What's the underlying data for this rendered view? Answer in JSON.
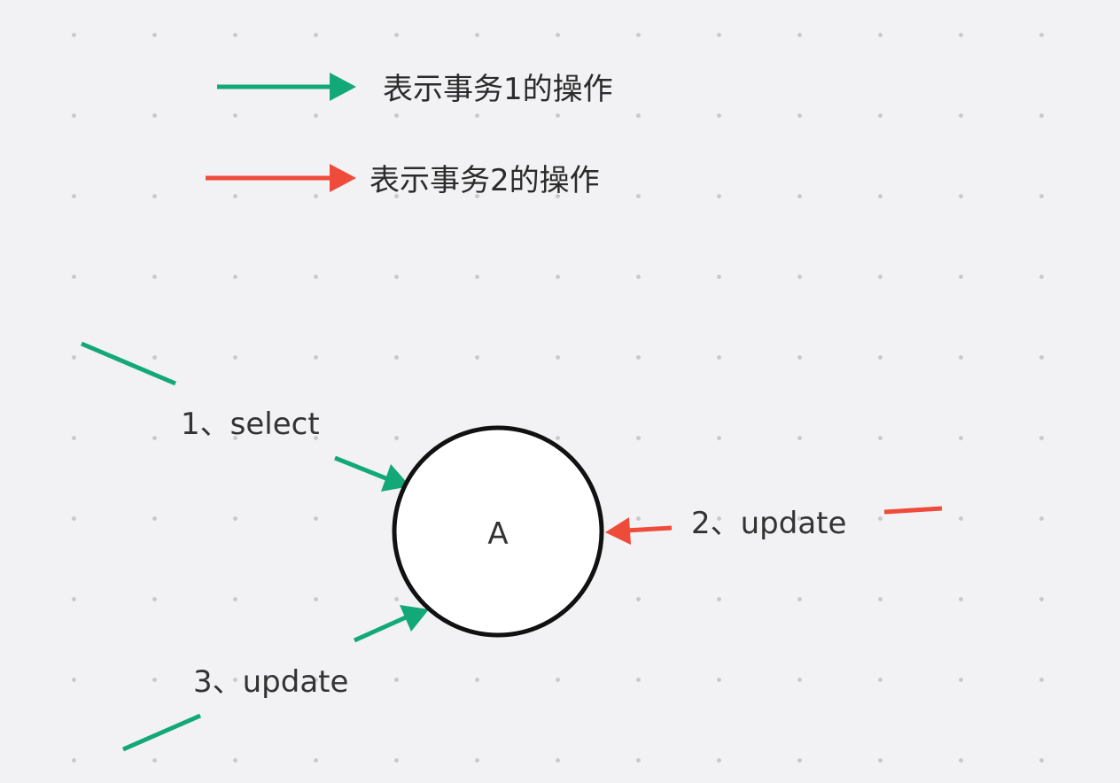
{
  "colors": {
    "transaction1": "#12a878",
    "transaction2": "#ef4b3b",
    "node_stroke": "#111111",
    "node_fill": "#ffffff"
  },
  "legend": {
    "transaction1_label": "表示事务1的操作",
    "transaction2_label": "表示事务2的操作"
  },
  "node": {
    "label": "A"
  },
  "operations": [
    {
      "label": "1、select",
      "transaction": "transaction1"
    },
    {
      "label": "2、update",
      "transaction": "transaction2"
    },
    {
      "label": "3、update",
      "transaction": "transaction1"
    }
  ]
}
